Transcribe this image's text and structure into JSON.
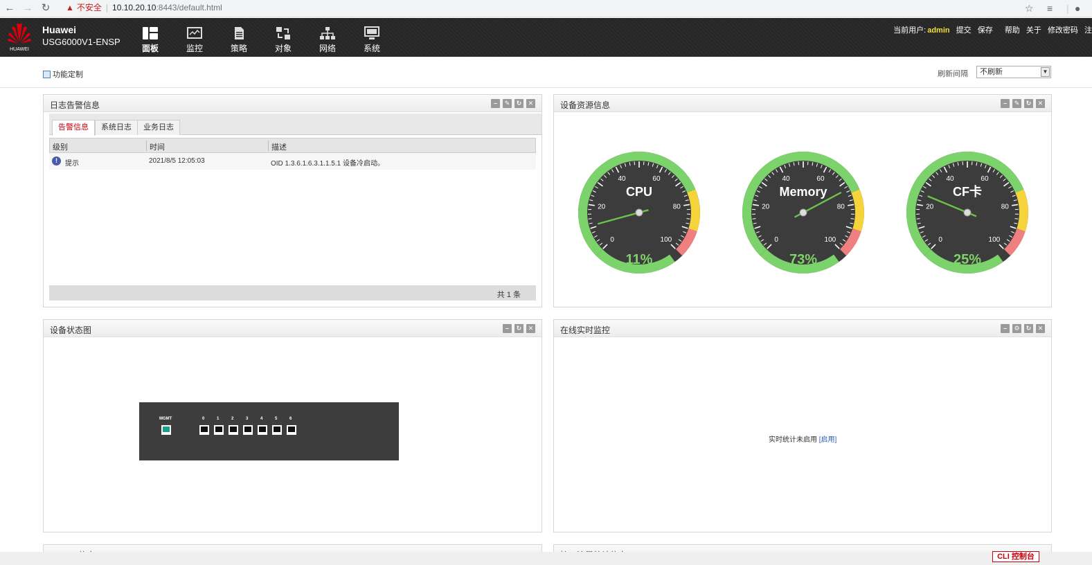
{
  "browser": {
    "back_icon": "arrow-left-icon",
    "warning": "不安全",
    "url_host": "10.10.20.10",
    "url_path": ":8443/default.html"
  },
  "header": {
    "brand_line1": "Huawei",
    "brand_line2": "USG6000V1-ENSP",
    "logo_text": "HUAWEI",
    "nav": [
      {
        "label": "面板",
        "icon": "dashboard-icon"
      },
      {
        "label": "监控",
        "icon": "monitor-icon"
      },
      {
        "label": "策略",
        "icon": "policy-icon"
      },
      {
        "label": "对象",
        "icon": "object-icon"
      },
      {
        "label": "网络",
        "icon": "network-icon"
      },
      {
        "label": "系统",
        "icon": "system-icon"
      }
    ],
    "current_user_label": "当前用户:",
    "current_user": "admin",
    "submit": "提交",
    "save": "保存",
    "help": "帮助",
    "about": "关于",
    "change_password": "修改密码",
    "logout_partial": "注"
  },
  "toolbar": {
    "customize": "功能定制",
    "refresh_label": "刷新间隔",
    "refresh_value": "不刷新"
  },
  "log_panel": {
    "title": "日志告警信息",
    "tabs": [
      "告警信息",
      "系统日志",
      "业务日志"
    ],
    "columns": [
      "级别",
      "时间",
      "描述"
    ],
    "rows": [
      {
        "level": "提示",
        "time": "2021/8/5 12:05:03",
        "desc": "OID 1.3.6.1.6.3.1.1.5.1 设备冷启动。"
      }
    ],
    "footer": "共 1 条"
  },
  "resource_panel": {
    "title": "设备资源信息",
    "gauges": [
      {
        "name": "CPU",
        "value": 11,
        "label": "11%"
      },
      {
        "name": "Memory",
        "value": 73,
        "label": "73%"
      },
      {
        "name": "CF卡",
        "value": 25,
        "label": "25%"
      }
    ],
    "ticks": [
      "0",
      "20",
      "40",
      "60",
      "80",
      "100"
    ]
  },
  "status_panel": {
    "title": "设备状态图",
    "mgmt_label": "MGMT",
    "ports": [
      "0",
      "1",
      "2",
      "3",
      "4",
      "5",
      "6"
    ]
  },
  "realtime_panel": {
    "title": "在线实时监控",
    "message": "实时统计未启用",
    "enable_link": "[启用]"
  },
  "bottom_panels": {
    "left_title": "License信息",
    "right_title": "接口流量统计信息"
  },
  "cli_button": "CLI 控制台",
  "colors": {
    "brand_red": "#c7000b",
    "gauge_green": "#7cd26b",
    "gauge_yellow": "#f5d43b",
    "gauge_red": "#f08080",
    "value_green": "#7fd36a",
    "user_yellow": "#f3df3b"
  }
}
